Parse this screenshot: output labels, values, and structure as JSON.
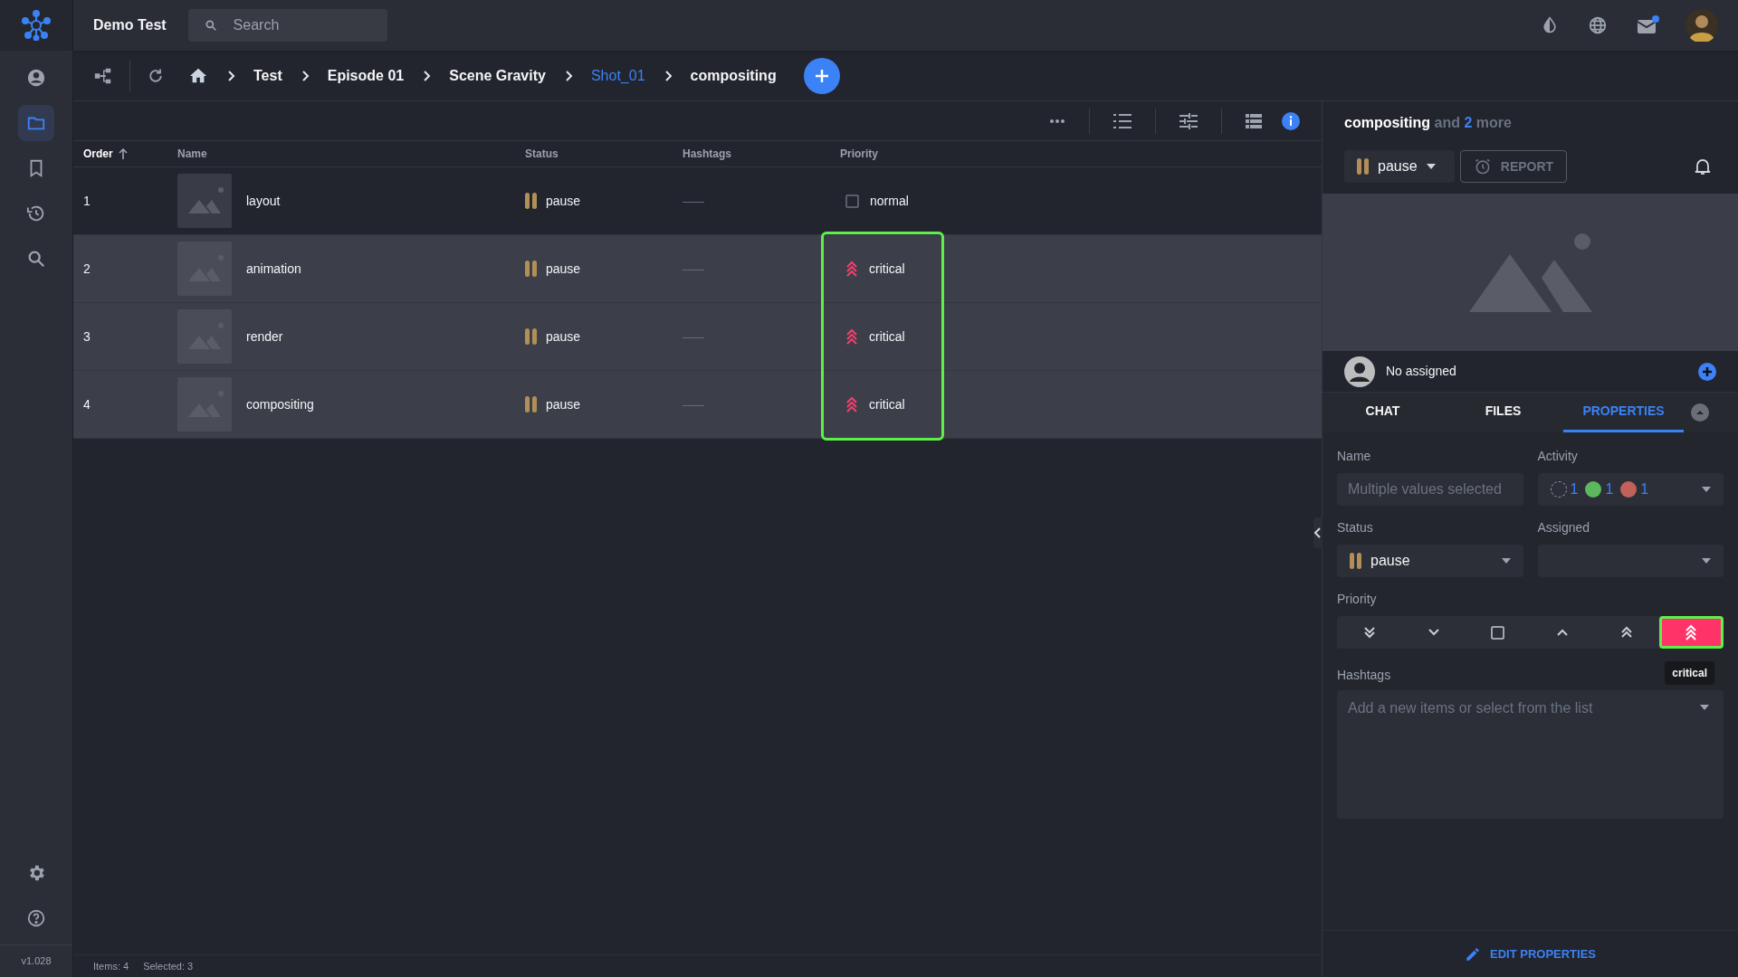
{
  "app": {
    "title": "Demo Test",
    "search_placeholder": "Search",
    "version": "v1.028"
  },
  "nav": [
    {
      "selected": false
    },
    {
      "selected": true
    },
    {
      "selected": false
    },
    {
      "selected": false
    },
    {
      "selected": false
    }
  ],
  "breadcrumbs": [
    {
      "label": "Test",
      "current": false
    },
    {
      "label": "Episode 01",
      "current": false
    },
    {
      "label": "Scene Gravity",
      "current": false
    },
    {
      "label": "Shot_01",
      "current": true
    },
    {
      "label": "compositing",
      "current": false
    }
  ],
  "table": {
    "columns": [
      "Order",
      "Name",
      "Status",
      "Hashtags",
      "Priority"
    ],
    "rows": [
      {
        "order": "1",
        "name": "layout",
        "status": "pause",
        "hashtags": "——",
        "priority": "normal",
        "kind": "normal",
        "selected": false,
        "highlighted": false
      },
      {
        "order": "2",
        "name": "animation",
        "status": "pause",
        "hashtags": "——",
        "priority": "critical",
        "kind": "critical",
        "selected": true,
        "highlighted": true
      },
      {
        "order": "3",
        "name": "render",
        "status": "pause",
        "hashtags": "——",
        "priority": "critical",
        "kind": "critical",
        "selected": true,
        "highlighted": true
      },
      {
        "order": "4",
        "name": "compositing",
        "status": "pause",
        "hashtags": "——",
        "priority": "critical",
        "kind": "critical",
        "selected": true,
        "highlighted": true
      }
    ]
  },
  "status_bar": {
    "items": "Items: 4",
    "selected": "Selected: 3"
  },
  "panel": {
    "title": "compositing",
    "and": "and",
    "count": "2",
    "more": "more",
    "status": "pause",
    "report": "REPORT",
    "assigned": "No assigned",
    "tabs": [
      {
        "label": "CHAT",
        "selected": false
      },
      {
        "label": "FILES",
        "selected": false
      },
      {
        "label": "PROPERTIES",
        "selected": true
      }
    ],
    "name_label": "Name",
    "name_placeholder": "Multiple values selected",
    "activity_label": "Activity",
    "activity": [
      {
        "kind": "empty",
        "count": "1"
      },
      {
        "kind": "filled",
        "color": "#5cb85c",
        "count": "1"
      },
      {
        "kind": "filled",
        "color": "#c0625a",
        "count": "1"
      }
    ],
    "status_label": "Status",
    "status_value": "pause",
    "assigned_label": "Assigned",
    "priority_label": "Priority",
    "priorities": [
      {
        "kind": "lowest",
        "selected": false,
        "highlighted": false
      },
      {
        "kind": "low",
        "selected": false,
        "highlighted": false
      },
      {
        "kind": "normal",
        "selected": false,
        "highlighted": false
      },
      {
        "kind": "high",
        "selected": false,
        "highlighted": false
      },
      {
        "kind": "higher",
        "selected": false,
        "highlighted": false
      },
      {
        "kind": "critical",
        "selected": true,
        "highlighted": true
      }
    ],
    "tooltip": "critical",
    "hashtags_label": "Hashtags",
    "hashtags_placeholder": "Add a new items or select from the list",
    "edit": "EDIT PROPERTIES"
  }
}
